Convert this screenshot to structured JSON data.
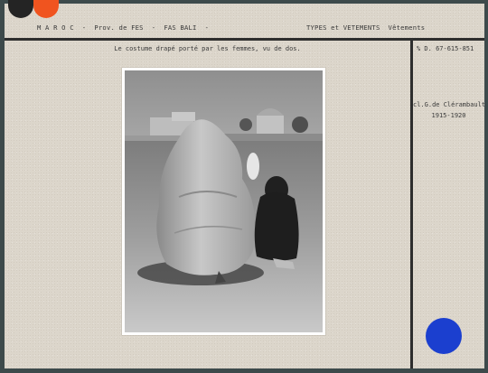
{
  "header": {
    "place": "M A R O C  -  Prov. de FES  -  FAS BALI  -",
    "category": "TYPES et VETEMENTS  Vêtements"
  },
  "caption": "Le costume drapé porté par les femmes, vu de dos.",
  "reference": "% D. 67-615-851",
  "credit": {
    "author": "cl.G.de Clérambault",
    "years": "1915-1920"
  },
  "colors": {
    "card": "#dcd6cb",
    "rule": "#2e2e2e",
    "stamp": "#1b3fcf",
    "corner_left": "#242424",
    "corner_right": "#f0541f"
  },
  "photo": {
    "subject": "women-in-draped-costume-seen-from-behind"
  }
}
